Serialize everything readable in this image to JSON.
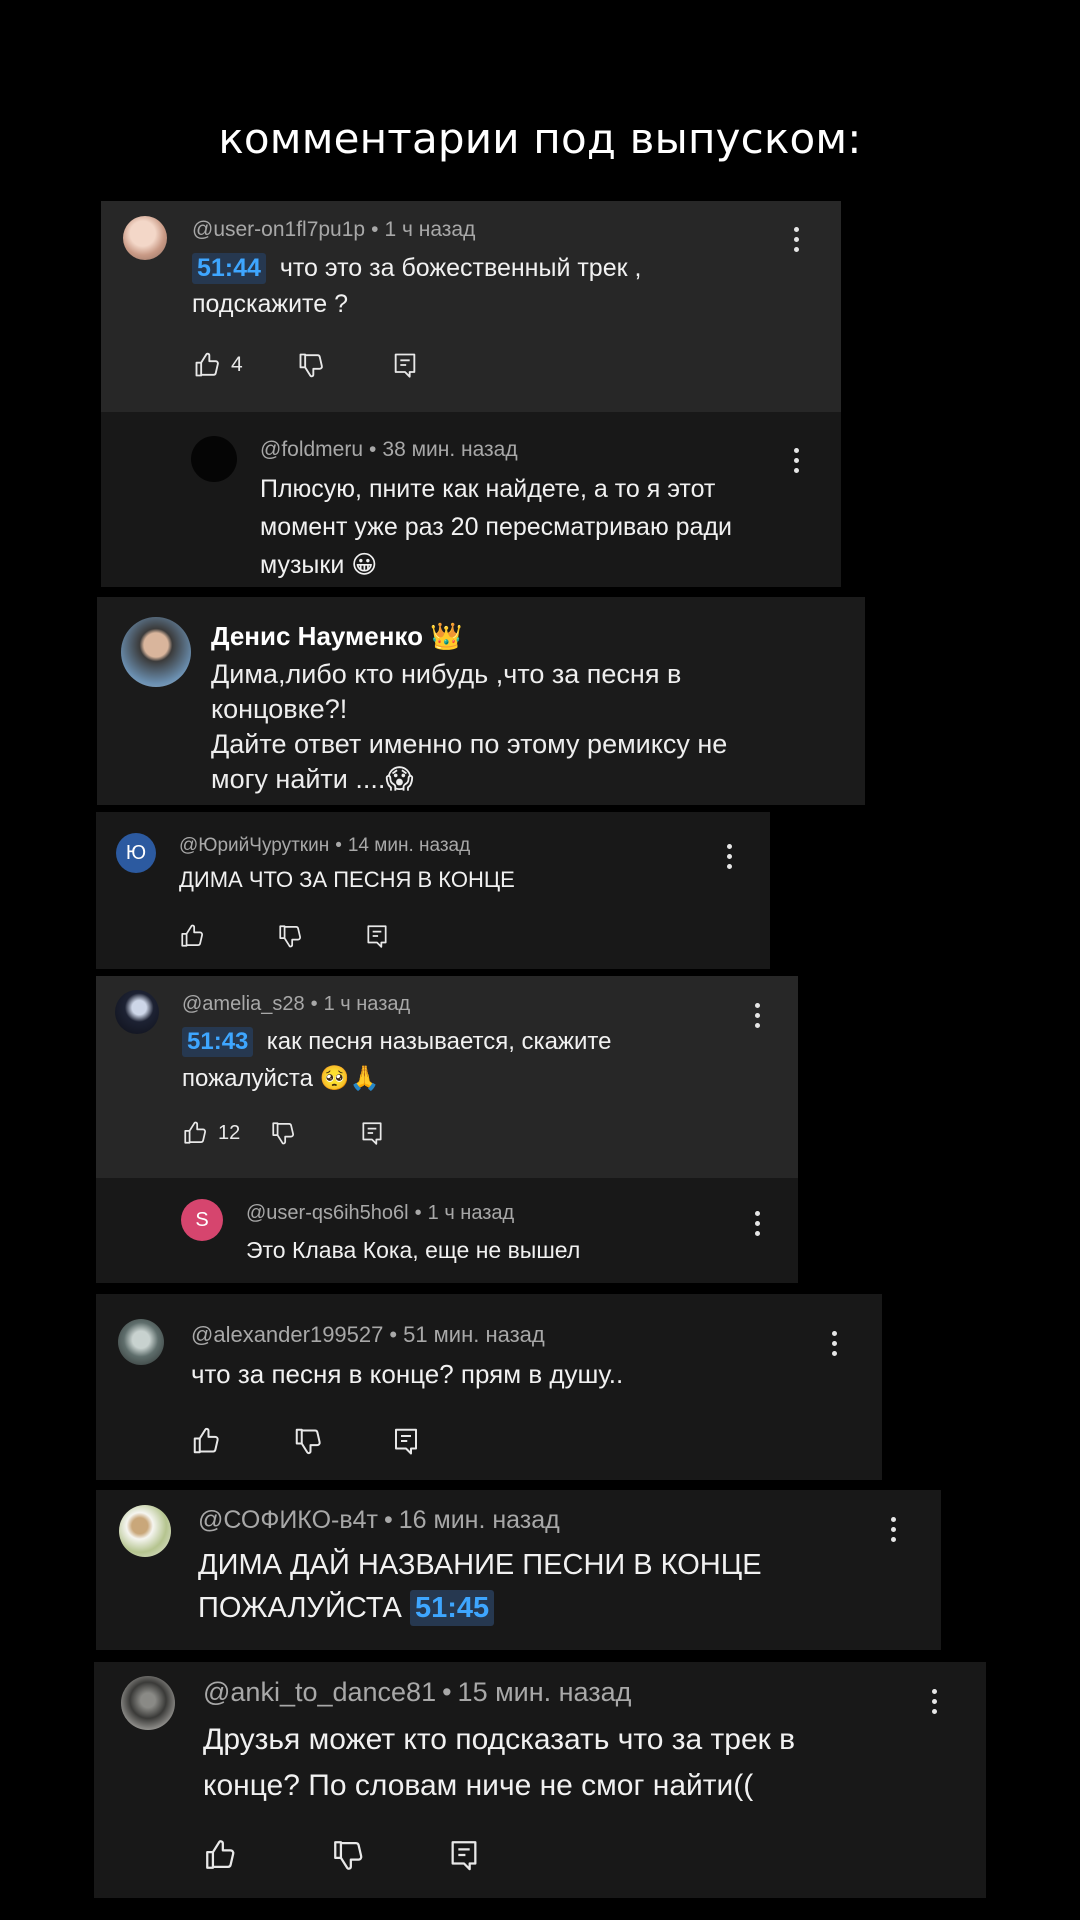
{
  "title": "комментарии под выпуском:",
  "c1": {
    "user": "@user-on1fl7pu1p",
    "time": "1 ч назад",
    "timestamp": "51:44",
    "text1": "что это за божественный трек ,",
    "text2": "подскажите ?",
    "likes": "4"
  },
  "c2": {
    "user": "@foldmeru",
    "time": "38 мин. назад",
    "line1": "Плюсую, пните как найдете, а то я этот",
    "line2": "момент уже раз 20 пересматриваю ради",
    "line3": "музыки",
    "emoji": "😀"
  },
  "c3": {
    "user": "Денис Науменко",
    "badge": "👑",
    "line1": "Дима,либо кто нибудь ,что за песня в",
    "line2": "концовке?!",
    "line3": "Дайте ответ именно по этому ремиксу не",
    "line4": "могу найти ....",
    "emoji": "😱"
  },
  "c4": {
    "avatar_letter": "Ю",
    "avatar_color": "#2c5aa0",
    "user": "@ЮрийЧуруткин",
    "time": "14 мин. назад",
    "text": "ДИМА ЧТО ЗА ПЕСНЯ В КОНЦЕ"
  },
  "c5": {
    "user": "@amelia_s28",
    "time": "1 ч назад",
    "timestamp": "51:43",
    "text1": "как песня называется, скажите",
    "text2": "пожалуйста",
    "emoji": "🥺🙏",
    "likes": "12"
  },
  "c6": {
    "avatar_letter": "S",
    "avatar_color": "#d6456e",
    "user": "@user-qs6ih5ho6l",
    "time": "1 ч назад",
    "text": "Это Клава Кока, еще не вышел"
  },
  "c7": {
    "user": "@alexander199527",
    "time": "51 мин. назад",
    "text": "что за песня в конце? прям в душу.."
  },
  "c8": {
    "user": "@СОФИКО-в4т",
    "time": "16 мин. назад",
    "line1": "ДИМА ДАЙ НАЗВАНИЕ ПЕСНИ В КОНЦЕ",
    "line2": "ПОЖАЛУЙСТА",
    "timestamp": "51:45"
  },
  "c9": {
    "user": "@anki_to_dance81",
    "time": "15 мин. назад",
    "line1": "Друзья может кто подсказать что за трек в",
    "line2": "конце? По словам ниче не смог найти(("
  },
  "icons": [
    "thumb-up-icon",
    "thumb-down-icon",
    "reply-icon",
    "more-vert-icon"
  ],
  "colors": {
    "card_light": "#272727",
    "card_dark": "#181818",
    "timestamp_link": "#3ea6ff",
    "meta_gray": "#a8a8a8"
  }
}
